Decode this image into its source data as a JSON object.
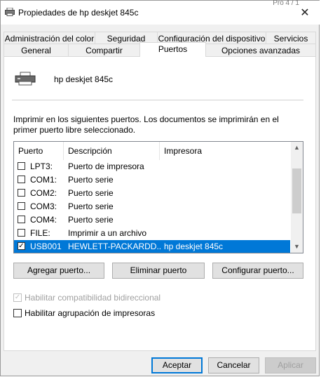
{
  "window": {
    "title": "Propiedades de hp deskjet 845c",
    "close_glyph": "✕",
    "background_fragment": "Pro 4 / 1"
  },
  "tabs": {
    "row_top": [
      "Administración del color",
      "Seguridad",
      "Configuración del dispositivo",
      "Servicios"
    ],
    "row_bottom": [
      "General",
      "Compartir",
      "Puertos",
      "Opciones avanzadas"
    ],
    "active": "Puertos"
  },
  "printer": {
    "name": "hp deskjet 845c",
    "icon": "printer-icon"
  },
  "description": "Imprimir en los siguientes puertos. Los documentos se imprimirán en el primer puerto libre seleccionado.",
  "port_list": {
    "columns": [
      "Puerto",
      "Descripción",
      "Impresora"
    ],
    "rows": [
      {
        "checked": false,
        "port": "LPT3:",
        "description": "Puerto de impresora",
        "printer": ""
      },
      {
        "checked": false,
        "port": "COM1:",
        "description": "Puerto serie",
        "printer": ""
      },
      {
        "checked": false,
        "port": "COM2:",
        "description": "Puerto serie",
        "printer": ""
      },
      {
        "checked": false,
        "port": "COM3:",
        "description": "Puerto serie",
        "printer": ""
      },
      {
        "checked": false,
        "port": "COM4:",
        "description": "Puerto serie",
        "printer": ""
      },
      {
        "checked": false,
        "port": "FILE:",
        "description": "Imprimir a un archivo",
        "printer": ""
      },
      {
        "checked": true,
        "selected": true,
        "port": "USB001",
        "description": "HEWLETT-PACKARDD...",
        "printer": "hp deskjet 845c"
      }
    ],
    "check_glyph": "✓",
    "scroll_up_glyph": "▲",
    "scroll_down_glyph": "▼"
  },
  "port_buttons": {
    "add": "Agregar puerto...",
    "remove": "Eliminar puerto",
    "configure": "Configurar puerto..."
  },
  "options": {
    "bidirectional": {
      "label": "Habilitar compatibilidad bidireccional",
      "checked": true,
      "disabled": true
    },
    "pooling": {
      "label": "Habilitar agrupación de impresoras",
      "checked": false,
      "disabled": false
    }
  },
  "dialog_buttons": {
    "ok": "Aceptar",
    "cancel": "Cancelar",
    "apply": "Aplicar"
  },
  "colors": {
    "selection": "#0078d7",
    "accent": "#0078d7"
  }
}
